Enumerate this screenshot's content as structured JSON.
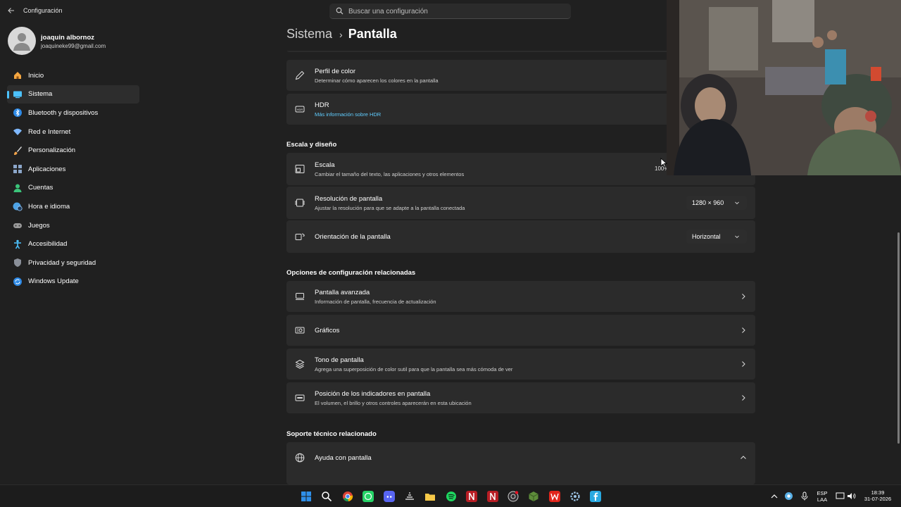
{
  "titlebar": {
    "app_title": "Configuración",
    "search_placeholder": "Buscar una configuración"
  },
  "profile": {
    "name": "joaquin albornoz",
    "email": "joaquineke99@gmail.com"
  },
  "sidebar": {
    "items": [
      {
        "label": "Inicio",
        "icon": "home-icon",
        "color": "#f4a640"
      },
      {
        "label": "Sistema",
        "icon": "system-icon",
        "color": "#4cc2ff",
        "active": true
      },
      {
        "label": "Bluetooth y dispositivos",
        "icon": "bluetooth-icon",
        "color": "#2e8ae6"
      },
      {
        "label": "Red e Internet",
        "icon": "wifi-icon",
        "color": "#7fb8ff"
      },
      {
        "label": "Personalización",
        "icon": "brush-icon",
        "color": "#f0a24a"
      },
      {
        "label": "Aplicaciones",
        "icon": "apps-icon",
        "color": "#8ba6c9"
      },
      {
        "label": "Cuentas",
        "icon": "person-icon",
        "color": "#3bc47a"
      },
      {
        "label": "Hora e idioma",
        "icon": "globe-clock-icon",
        "color": "#4ea3e6"
      },
      {
        "label": "Juegos",
        "icon": "gamepad-icon",
        "color": "#9a9a9a"
      },
      {
        "label": "Accesibilidad",
        "icon": "accessibility-icon",
        "color": "#4cc2ff"
      },
      {
        "label": "Privacidad y seguridad",
        "icon": "shield-icon",
        "color": "#8a8f99"
      },
      {
        "label": "Windows Update",
        "icon": "update-icon",
        "color": "#2e8ae6"
      }
    ]
  },
  "header": {
    "parent": "Sistema",
    "separator": "›",
    "current": "Pantalla"
  },
  "cards_top": [
    {
      "title": "Perfil de color",
      "desc": "Determinar cómo aparecen los colores en la pantalla",
      "icon": "pen-icon"
    },
    {
      "title": "HDR",
      "link": "Más información sobre HDR",
      "icon": "hdr-icon"
    }
  ],
  "sections": {
    "scale": "Escala y diseño",
    "related": "Opciones de configuración relacionadas",
    "support": "Soporte técnico relacionado"
  },
  "scale_cards": [
    {
      "title": "Escala",
      "desc": "Cambiar el tamaño del texto, las aplicaciones y otros elementos",
      "value": "100%",
      "icon": "scale-icon"
    },
    {
      "title": "Resolución de pantalla",
      "desc": "Ajustar la resolución para que se adapte a la pantalla conectada",
      "value": "1280 × 960",
      "icon": "resolution-icon"
    },
    {
      "title": "Orientación de la pantalla",
      "value": "Horizontal",
      "icon": "orientation-icon"
    }
  ],
  "related_cards": [
    {
      "title": "Pantalla avanzada",
      "desc": "Información de pantalla, frecuencia de actualización",
      "icon": "monitor-icon"
    },
    {
      "title": "Gráficos",
      "icon": "graphics-icon"
    },
    {
      "title": "Tono de pantalla",
      "desc": "Agrega una superposición de color sutil para que la pantalla sea más cómoda de ver",
      "icon": "layers-icon"
    },
    {
      "title": "Posición de los indicadores en pantalla",
      "desc": "El volumen, el brillo y otros controles aparecerán en esta ubicación",
      "icon": "indicator-icon"
    }
  ],
  "support_cards": [
    {
      "title": "Ayuda con pantalla",
      "icon": "globe-icon"
    }
  ],
  "taskbar": {
    "apps": [
      "windows-start-icon",
      "search-icon",
      "chrome-icon",
      "whatsapp-icon",
      "discord-icon",
      "app-icon",
      "file-explorer-icon",
      "spotify-icon",
      "netflix-icon",
      "netflix-icon",
      "obs-icon",
      "minecraft-icon",
      "wps-icon",
      "settings-icon",
      "facebook-icon"
    ],
    "lang_top": "ESP",
    "lang_bottom": "LAA",
    "time": "18:39",
    "date": "31-07-2026"
  }
}
